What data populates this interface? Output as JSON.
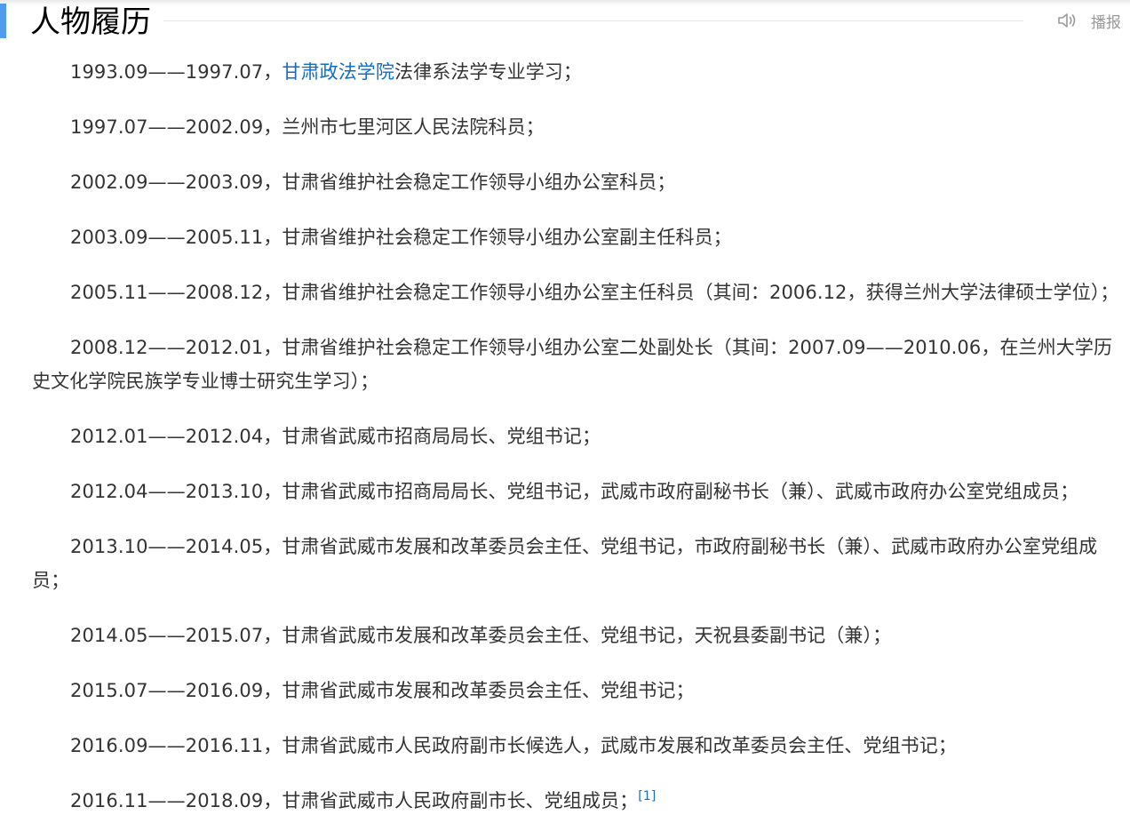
{
  "section": {
    "title": "人物履历",
    "play_label": "播报",
    "play_icon": "speaker-icon",
    "accent_color": "#4f9cee",
    "link_color": "#136ec2"
  },
  "entries": [
    {
      "pre": "1993.09——1997.07，",
      "link": "甘肃政法学院",
      "post": "法律系法学专业学习；"
    },
    {
      "text": "1997.07——2002.09，兰州市七里河区人民法院科员；"
    },
    {
      "text": "2002.09——2003.09，甘肃省维护社会稳定工作领导小组办公室科员；"
    },
    {
      "text": "2003.09——2005.11，甘肃省维护社会稳定工作领导小组办公室副主任科员；"
    },
    {
      "text": "2005.11——2008.12，甘肃省维护社会稳定工作领导小组办公室主任科员（其间：2006.12，获得兰州大学法律硕士学位）；"
    },
    {
      "text": "2008.12——2012.01，甘肃省维护社会稳定工作领导小组办公室二处副处长（其间：2007.09——2010.06，在兰州大学历史文化学院民族学专业博士研究生学习）；"
    },
    {
      "text": "2012.01——2012.04，甘肃省武威市招商局局长、党组书记；"
    },
    {
      "text": "2012.04——2013.10，甘肃省武威市招商局局长、党组书记，武威市政府副秘书长（兼）、武威市政府办公室党组成员；"
    },
    {
      "text": "2013.10——2014.05，甘肃省武威市发展和改革委员会主任、党组书记，市政府副秘书长（兼）、武威市政府办公室党组成员；"
    },
    {
      "text": "2014.05——2015.07，甘肃省武威市发展和改革委员会主任、党组书记，天祝县委副书记（兼）；"
    },
    {
      "text": "2015.07——2016.09，甘肃省武威市发展和改革委员会主任、党组书记；"
    },
    {
      "text": "2016.09——2016.11，甘肃省武威市人民政府副市长候选人，武威市发展和改革委员会主任、党组书记；"
    },
    {
      "text": "2016.11——2018.09，甘肃省武威市人民政府副市长、党组成员；",
      "ref": "[1]"
    }
  ]
}
